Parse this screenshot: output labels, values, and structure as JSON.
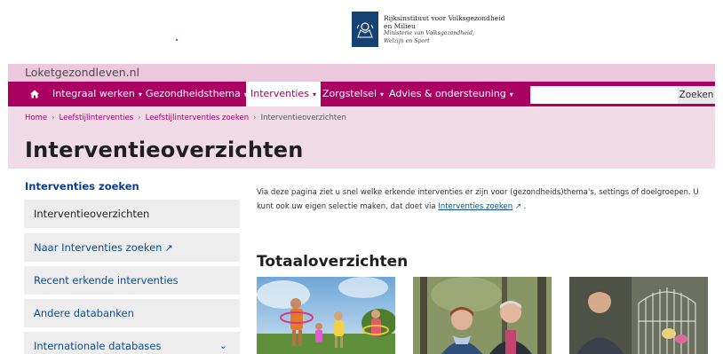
{
  "header": {
    "logo_lines": [
      "Rijksinstituut voor Volksgezondheid",
      "en Milieu",
      "Ministerie van Volksgezondheid,",
      "Welzijn en Sport"
    ]
  },
  "site": {
    "name": "Loketgezondleven.nl"
  },
  "nav": {
    "items": [
      {
        "label": "Integraal werken",
        "caret": "▾"
      },
      {
        "label": "Gezondheidsthema",
        "caret": "▾"
      },
      {
        "label": "Interventies",
        "caret": "▾"
      },
      {
        "label": "Zorgstelsel",
        "caret": "▾"
      },
      {
        "label": "Advies & ondersteuning",
        "caret": "▾"
      }
    ],
    "search_button": "Zoeken",
    "search_placeholder": ""
  },
  "breadcrumb": {
    "items": [
      "Home",
      "Leefstijlinterventies",
      "Leefstijlinterventies zoeken",
      "Interventieoverzichten"
    ],
    "separator": "›"
  },
  "page": {
    "title": "Interventieoverzichten"
  },
  "sidebar": {
    "heading": "Interventies zoeken",
    "items": [
      {
        "label": "Interventieoverzichten"
      },
      {
        "label": "Naar Interventies zoeken",
        "icon": "↗"
      },
      {
        "label": "Recent erkende interventies"
      },
      {
        "label": "Andere databanken"
      },
      {
        "label": "Internationale databases",
        "icon": "⌄"
      }
    ]
  },
  "main": {
    "intro_text": "Via deze pagina ziet u snel welke erkende interventies er zijn voor (gezondheids)thema's, settings of doelgroepen. U kunt ook uw eigen selectie maken, dat doet via ",
    "intro_link": "Interventies zoeken",
    "intro_link_icon": "↗",
    "intro_end": " .",
    "section_title": "Totaaloverzichten",
    "photos": [
      "children-playing-photo",
      "elderly-couple-photo",
      "man-with-birdcage-photo"
    ]
  },
  "colors": {
    "nav_bg": "#a90061",
    "site_bar_bg": "#ecc8dc",
    "title_band_bg": "#f1dbe7",
    "link_blue": "#0b4f94",
    "logo_blue": "#154273"
  }
}
